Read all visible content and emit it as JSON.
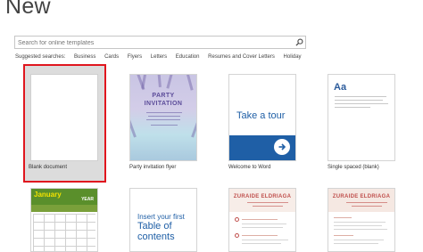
{
  "page": {
    "title": "New"
  },
  "search": {
    "placeholder": "Search for online templates"
  },
  "suggested": {
    "label": "Suggested searches:",
    "items": [
      "Business",
      "Cards",
      "Flyers",
      "Letters",
      "Education",
      "Resumes and Cover Letters",
      "Holiday"
    ]
  },
  "templates": [
    {
      "caption": "Blank document",
      "selected": true
    },
    {
      "caption": "Party invitation flyer",
      "thumb_title_1": "PARTY",
      "thumb_title_2": "INVITATION"
    },
    {
      "caption": "Welcome to Word",
      "thumb_text": "Take a tour"
    },
    {
      "caption": "Single spaced (blank)",
      "thumb_text": "Aa"
    },
    {
      "caption": "",
      "thumb_month": "January",
      "thumb_year": "YEAR"
    },
    {
      "caption": "",
      "thumb_small": "Insert your first",
      "thumb_big": "Table of contents"
    },
    {
      "caption": "",
      "thumb_name": "ZURAIDE ELDRIAGA"
    },
    {
      "caption": "",
      "thumb_name": "ZURAIDE ELDRIAGA"
    }
  ],
  "colors": {
    "selection": "#e0161e",
    "accent": "#1f5fa6",
    "resume": "#c0504d",
    "calendar": "#5a8f2b"
  },
  "icons": {
    "search": "search-icon",
    "arrow": "arrow-right-icon"
  }
}
